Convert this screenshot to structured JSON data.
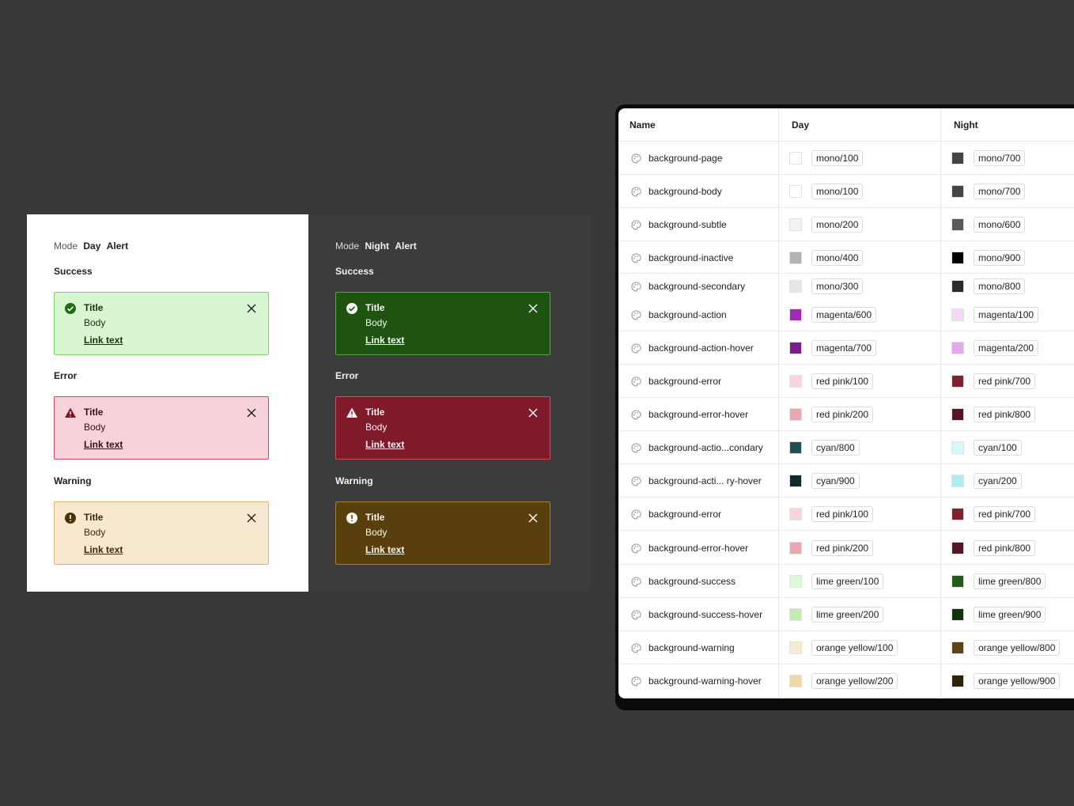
{
  "day_panel": {
    "mode_label": "Mode",
    "mode_value": "Day",
    "component": "Alert",
    "sections": [
      {
        "label": "Success",
        "title": "Title",
        "body": "Body",
        "link": "Link text",
        "icon": "check-circle-icon"
      },
      {
        "label": "Error",
        "title": "Title",
        "body": "Body",
        "link": "Link text",
        "icon": "warning-triangle-icon"
      },
      {
        "label": "Warning",
        "title": "Title",
        "body": "Body",
        "link": "Link text",
        "icon": "exclamation-circle-icon"
      }
    ]
  },
  "night_panel": {
    "mode_label": "Mode",
    "mode_value": "Night",
    "component": "Alert",
    "sections": [
      {
        "label": "Success",
        "title": "Title",
        "body": "Body",
        "link": "Link text",
        "icon": "check-circle-icon"
      },
      {
        "label": "Error",
        "title": "Title",
        "body": "Body",
        "link": "Link text",
        "icon": "warning-triangle-icon"
      },
      {
        "label": "Warning",
        "title": "Title",
        "body": "Body",
        "link": "Link text",
        "icon": "exclamation-circle-icon"
      }
    ]
  },
  "token_table": {
    "headers": {
      "name": "Name",
      "day": "Day",
      "night": "Night"
    },
    "rows": [
      {
        "name": "background-page",
        "day": "mono/100",
        "day_color": "#ffffff",
        "night": "mono/700",
        "night_color": "#444444"
      },
      {
        "name": "background-body",
        "day": "mono/100",
        "day_color": "#ffffff",
        "night": "mono/700",
        "night_color": "#444444"
      },
      {
        "name": "background-subtle",
        "day": "mono/200",
        "day_color": "#f3f3f3",
        "night": "mono/600",
        "night_color": "#595959"
      },
      {
        "name": "background-inactive",
        "day": "mono/400",
        "day_color": "#b3b3b3",
        "night": "mono/900",
        "night_color": "#000000"
      },
      {
        "name": "background-secondary",
        "day": "mono/300",
        "day_color": "#e6e6e6",
        "night": "mono/800",
        "night_color": "#2a2a2a"
      },
      {
        "name": "background-action",
        "day": "magenta/600",
        "day_color": "#a22ab5",
        "night": "magenta/100",
        "night_color": "#f5d8f7"
      },
      {
        "name": "background-action-hover",
        "day": "magenta/700",
        "day_color": "#7b1f87",
        "night": "magenta/200",
        "night_color": "#e8a8ef"
      },
      {
        "name": "background-error",
        "day": "red pink/100",
        "day_color": "#f7d5db",
        "night": "red pink/700",
        "night_color": "#7f2230"
      },
      {
        "name": "background-error-hover",
        "day": "red pink/200",
        "day_color": "#eaa6b1",
        "night": "red pink/800",
        "night_color": "#541622"
      },
      {
        "name": "background-actio...condary",
        "day": "cyan/800",
        "day_color": "#1e4e52",
        "night": "cyan/100",
        "night_color": "#d6f8f9"
      },
      {
        "name": "background-acti... ry-hover",
        "day": "cyan/900",
        "day_color": "#0f2a2d",
        "night": "cyan/200",
        "night_color": "#aeecf0"
      },
      {
        "name": "background-error",
        "day": "red pink/100",
        "day_color": "#f7d5db",
        "night": "red pink/700",
        "night_color": "#7f2230"
      },
      {
        "name": "background-error-hover",
        "day": "red pink/200",
        "day_color": "#eaa6b1",
        "night": "red pink/800",
        "night_color": "#541622"
      },
      {
        "name": "background-success",
        "day": "lime green/100",
        "day_color": "#e1f6db",
        "night": "lime green/800",
        "night_color": "#245a1b"
      },
      {
        "name": "background-success-hover",
        "day": "lime green/200",
        "day_color": "#c1edb4",
        "night": "lime green/900",
        "night_color": "#133010"
      },
      {
        "name": "background-warning",
        "day": "orange yellow/100",
        "day_color": "#f8ebd6",
        "night": "orange yellow/800",
        "night_color": "#5e4316"
      },
      {
        "name": "background-warning-hover",
        "day": "orange yellow/200",
        "day_color": "#f0d7a6",
        "night": "orange yellow/900",
        "night_color": "#2f220c"
      }
    ]
  }
}
